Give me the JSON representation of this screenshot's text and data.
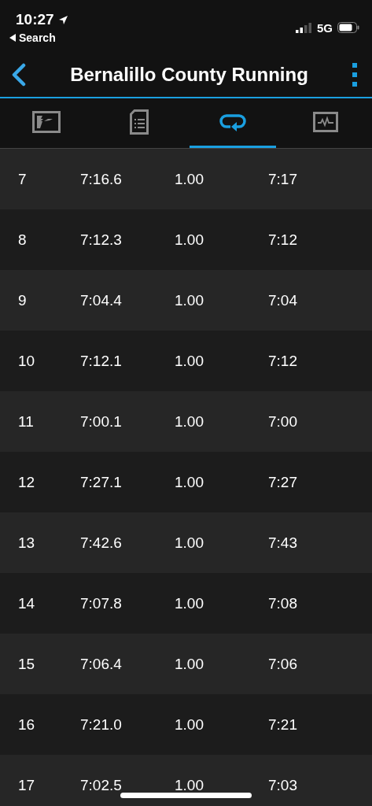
{
  "status_bar": {
    "time": "10:27",
    "back_link": "Search",
    "network": "5G"
  },
  "nav": {
    "title": "Bernalillo County Running"
  },
  "tabs": [
    {
      "kind": "map",
      "selected": false
    },
    {
      "kind": "details",
      "selected": false
    },
    {
      "kind": "laps",
      "selected": true
    },
    {
      "kind": "chart",
      "selected": false
    }
  ],
  "laps": [
    {
      "lap": "7",
      "time": "7:16.6",
      "distance": "1.00",
      "pace": "7:17"
    },
    {
      "lap": "8",
      "time": "7:12.3",
      "distance": "1.00",
      "pace": "7:12"
    },
    {
      "lap": "9",
      "time": "7:04.4",
      "distance": "1.00",
      "pace": "7:04"
    },
    {
      "lap": "10",
      "time": "7:12.1",
      "distance": "1.00",
      "pace": "7:12"
    },
    {
      "lap": "11",
      "time": "7:00.1",
      "distance": "1.00",
      "pace": "7:00"
    },
    {
      "lap": "12",
      "time": "7:27.1",
      "distance": "1.00",
      "pace": "7:27"
    },
    {
      "lap": "13",
      "time": "7:42.6",
      "distance": "1.00",
      "pace": "7:43"
    },
    {
      "lap": "14",
      "time": "7:07.8",
      "distance": "1.00",
      "pace": "7:08"
    },
    {
      "lap": "15",
      "time": "7:06.4",
      "distance": "1.00",
      "pace": "7:06"
    },
    {
      "lap": "16",
      "time": "7:21.0",
      "distance": "1.00",
      "pace": "7:21"
    },
    {
      "lap": "17",
      "time": "7:02.5",
      "distance": "1.00",
      "pace": "7:03"
    }
  ]
}
